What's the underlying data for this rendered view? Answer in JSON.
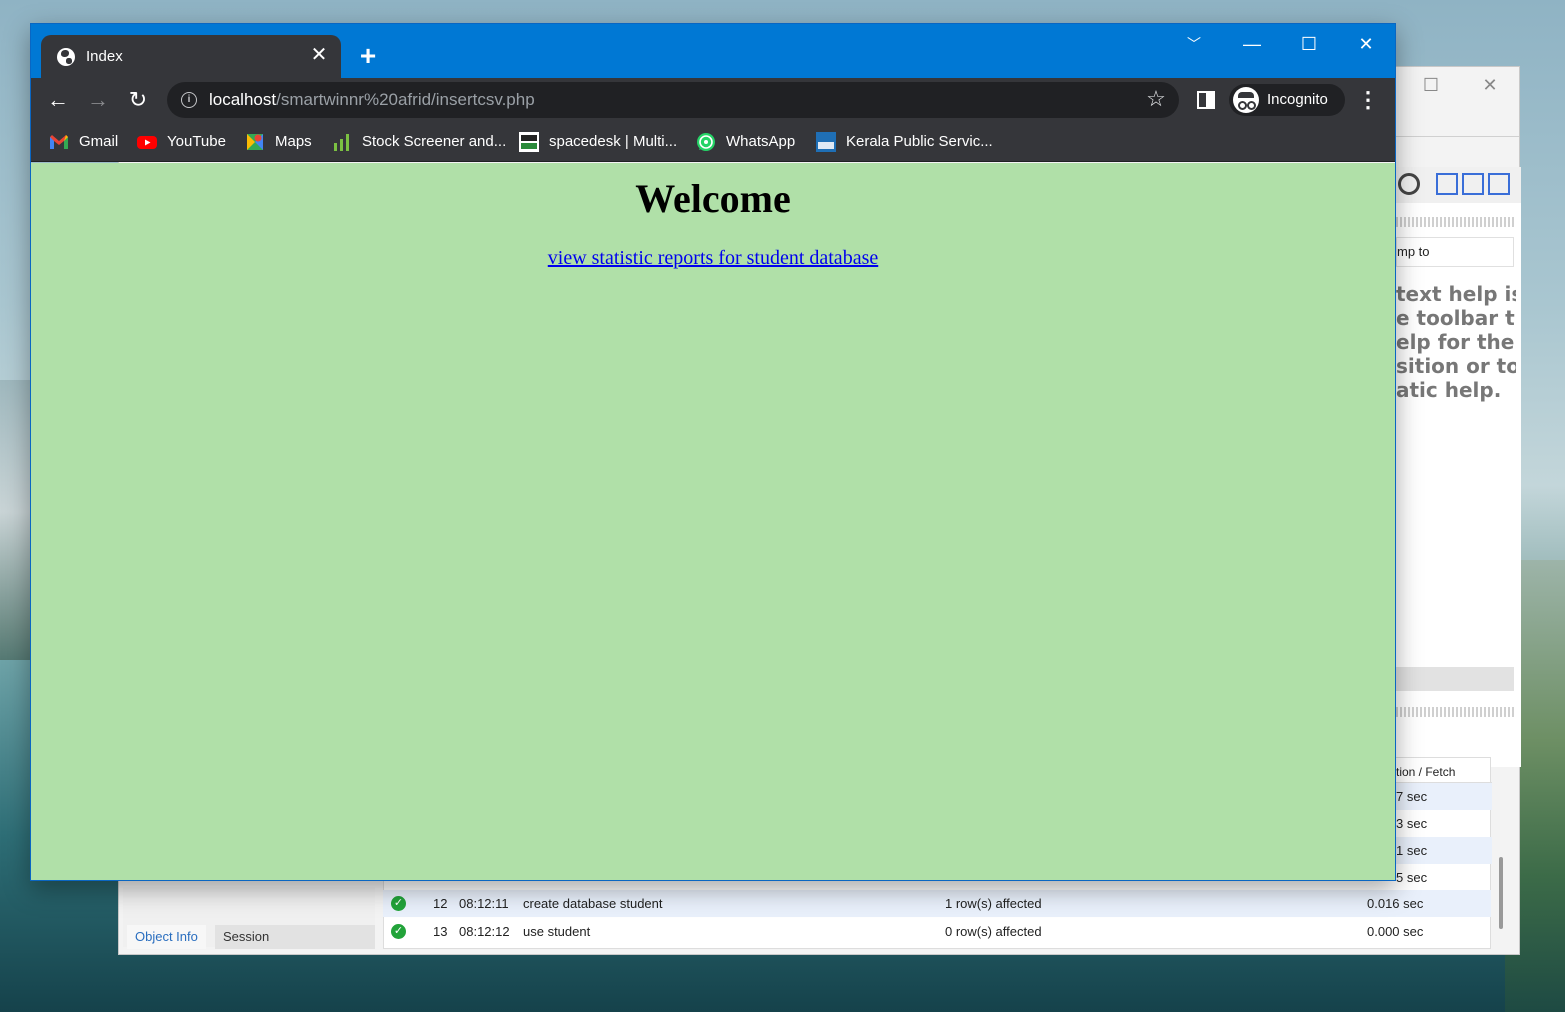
{
  "browser": {
    "tab_title": "Index",
    "new_tab": "+",
    "url_host": "localhost",
    "url_path": "/smartwinnr%20afrid/insertcsv.php",
    "profile_label": "Incognito",
    "bookmarks": [
      {
        "label": "Gmail",
        "icon": "gmail-icon"
      },
      {
        "label": "YouTube",
        "icon": "youtube-icon"
      },
      {
        "label": "Maps",
        "icon": "maps-icon"
      },
      {
        "label": "Stock Screener and...",
        "icon": "stock-chart-icon"
      },
      {
        "label": "spacedesk | Multi...",
        "icon": "spacedesk-icon"
      },
      {
        "label": "WhatsApp",
        "icon": "whatsapp-icon"
      },
      {
        "label": "Kerala Public Servic...",
        "icon": "kerala-psc-icon"
      }
    ]
  },
  "page": {
    "heading": "Welcome",
    "link_text": "view statistic reports for student database",
    "background": "#b0e0a8"
  },
  "background_app": {
    "jump_to_partial": "mp to",
    "help_text_partial": "text help is\ne toolbar t\nelp for the\nsition or to\natic help.",
    "fetch_header_partial": "tion / Fetch",
    "fetch_partials": [
      "7 sec",
      "3 sec",
      "1 sec",
      "5 sec"
    ],
    "rows": [
      {
        "num": "12",
        "time": "08:12:11",
        "action": "create database student",
        "message": "1 row(s) affected",
        "duration": "0.016 sec"
      },
      {
        "num": "13",
        "time": "08:12:12",
        "action": "use student",
        "message": "0 row(s) affected",
        "duration": "0.000 sec"
      }
    ],
    "tabs": [
      "Object Info",
      "Session"
    ]
  }
}
